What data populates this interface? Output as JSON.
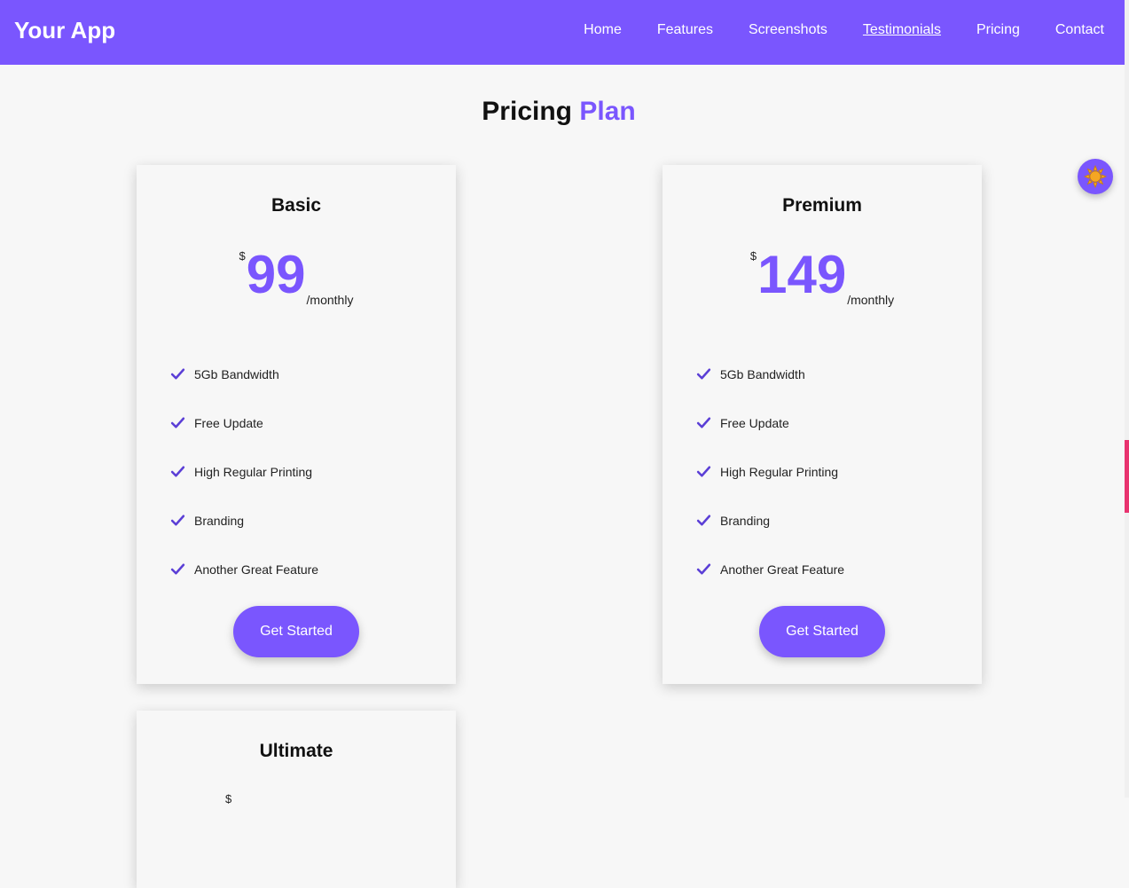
{
  "header": {
    "brand": "Your App",
    "nav": [
      {
        "label": "Home",
        "active": false
      },
      {
        "label": "Features",
        "active": false
      },
      {
        "label": "Screenshots",
        "active": false
      },
      {
        "label": "Testimonials",
        "active": true
      },
      {
        "label": "Pricing",
        "active": false
      },
      {
        "label": "Contact",
        "active": false
      }
    ]
  },
  "section": {
    "title_main": "Pricing",
    "title_accent": "Plan"
  },
  "theme_toggle": {
    "icon": "sun-icon"
  },
  "plans": [
    {
      "name": "Basic",
      "currency": "$",
      "price": "99",
      "period": "/monthly",
      "features": [
        "5Gb Bandwidth",
        "Free Update",
        "High Regular Printing",
        "Branding",
        "Another Great Feature"
      ],
      "cta": "Get Started"
    },
    {
      "name": "Premium",
      "currency": "$",
      "price": "149",
      "period": "/monthly",
      "features": [
        "5Gb Bandwidth",
        "Free Update",
        "High Regular Printing",
        "Branding",
        "Another Great Feature"
      ],
      "cta": "Get Started"
    },
    {
      "name": "Ultimate",
      "currency": "$"
    }
  ],
  "colors": {
    "accent": "#7a56fe",
    "background": "#f7f7f7",
    "scroll_indicator": "#e8336f",
    "sun": "#f5a623"
  }
}
